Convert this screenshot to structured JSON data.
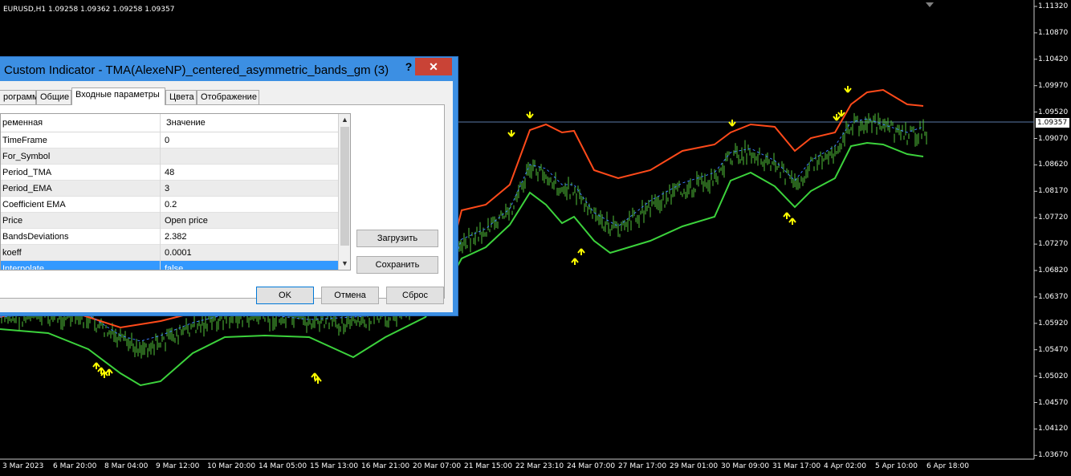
{
  "chart": {
    "symbol_info": "EURUSD,H1  1.09258 1.09362 1.09258 1.09357",
    "current_price": "1.09357",
    "price_labels": [
      "1.11320",
      "1.10870",
      "1.10420",
      "1.09970",
      "1.09520",
      "1.09070",
      "1.08620",
      "1.08170",
      "1.07720",
      "1.07270",
      "1.06820",
      "1.06370",
      "1.05920",
      "1.05470",
      "1.05020",
      "1.04570",
      "1.04120",
      "1.03670"
    ],
    "time_labels": [
      "3 Mar 2023",
      "6 Mar 20:00",
      "8 Mar 04:00",
      "9 Mar 12:00",
      "10 Mar 20:00",
      "14 Mar 05:00",
      "15 Mar 13:00",
      "16 Mar 21:00",
      "20 Mar 07:00",
      "21 Mar 15:00",
      "22 Mar 23:10",
      "24 Mar 07:00",
      "27 Mar 17:00",
      "29 Mar 01:00",
      "30 Mar 09:00",
      "31 Mar 17:00",
      "4 Apr 02:00",
      "5 Apr 10:00",
      "6 Apr 18:00"
    ],
    "colors": {
      "upper_band": "#ff4a1a",
      "lower_band": "#3cd23c",
      "center_line": "#3c7cff",
      "bars": "#52c23a",
      "arrows": "#ffff00"
    }
  },
  "dialog": {
    "title": "Custom Indicator - TMA(AlexeNP)_centered_asymmetric_bands_gm (3)",
    "help": "?",
    "close": "✕",
    "tabs": [
      "рограмме",
      "Общие",
      "Входные параметры",
      "Цвета",
      "Отображение"
    ],
    "active_tab": 2,
    "columns": {
      "name": "ременная",
      "value": "Значение"
    },
    "rows": [
      {
        "name": "TimeFrame",
        "value": "0"
      },
      {
        "name": "For_Symbol",
        "value": ""
      },
      {
        "name": "Period_TMA",
        "value": "48"
      },
      {
        "name": "Period_EMA",
        "value": "3"
      },
      {
        "name": "Coefficient EMA",
        "value": "0.2"
      },
      {
        "name": "Price",
        "value": "Open price"
      },
      {
        "name": "BandsDeviations",
        "value": "2.382"
      },
      {
        "name": "koeff",
        "value": "0.0001"
      },
      {
        "name": "Interpolate",
        "value": "false"
      }
    ],
    "load_btn": "Загрузить",
    "save_btn": "Сохранить",
    "ok_btn": "OK",
    "cancel_btn": "Отмена",
    "reset_btn": "Сброс"
  }
}
